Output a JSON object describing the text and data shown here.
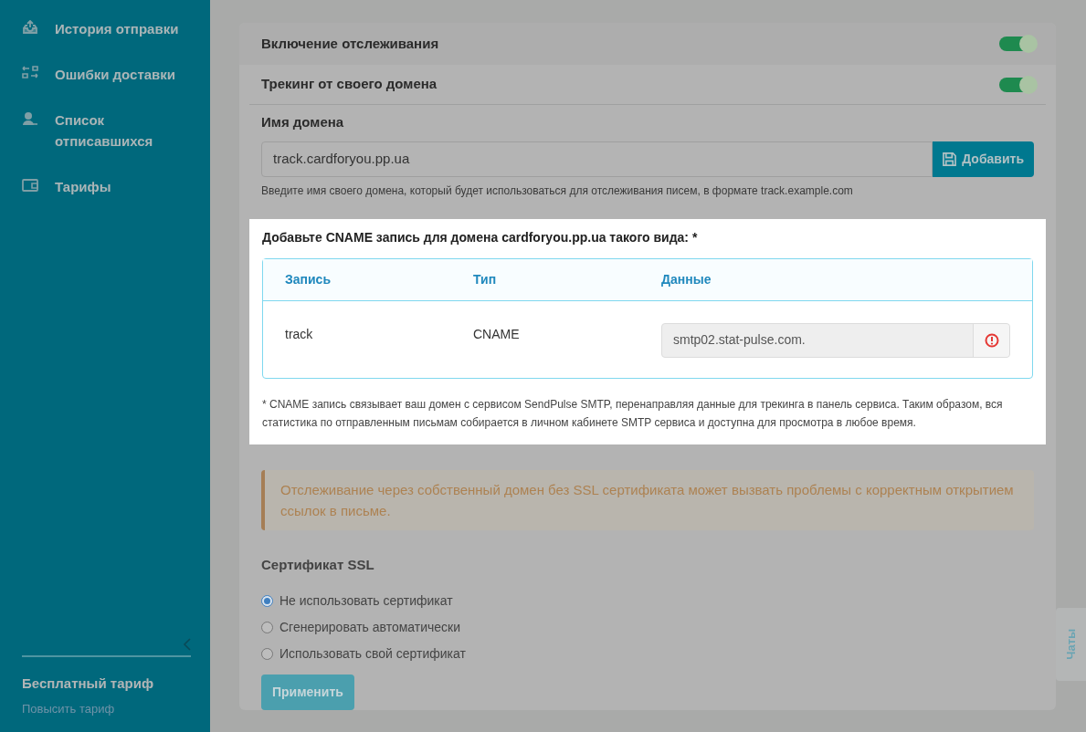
{
  "sidebar": {
    "items": [
      {
        "label": "История отправки"
      },
      {
        "label": "Ошибки доставки"
      },
      {
        "label": "Список отписавшихся"
      },
      {
        "label": "Тарифы"
      }
    ],
    "plan": {
      "title": "Бесплатный тариф",
      "link": "Повысить тариф"
    }
  },
  "toggles": [
    {
      "label": "Включение отслеживания",
      "on": true
    },
    {
      "label": "Трекинг от своего домена",
      "on": true
    }
  ],
  "domain": {
    "label": "Имя домена",
    "value": "track.cardforyou.pp.ua",
    "button": "Добавить",
    "hint": "Введите имя своего домена, который будет использоваться для отслеживания писем, в формате track.example.com"
  },
  "cname": {
    "title": "Добавьте CNAME запись для домена cardforyou.pp.ua такого вида: *",
    "columns": [
      "Запись",
      "Тип",
      "Данные"
    ],
    "rows": [
      {
        "record": "track",
        "type": "CNAME",
        "data": "smtp02.stat-pulse.com."
      }
    ],
    "note": "* CNAME запись связывает ваш домен с сервисом SendPulse SMTP, перенаправляя данные для трекинга в панель сервиса. Таким образом, вся статистика по отправленным письмам собирается в личном кабинете SMTP сервиса и доступна для просмотра в любое время."
  },
  "warning": "Отслеживание через собственный домен без SSL сертификата может вызвать проблемы с корректным открытием ссылок в письме.",
  "ssl": {
    "title": "Сертификат SSL",
    "options": [
      {
        "label": "Не использовать сертификат",
        "selected": true
      },
      {
        "label": "Сгенерировать автоматически",
        "selected": false
      },
      {
        "label": "Использовать свой сертификат",
        "selected": false
      }
    ]
  },
  "apply_button": "Применить",
  "chat_tab": "Чаты"
}
